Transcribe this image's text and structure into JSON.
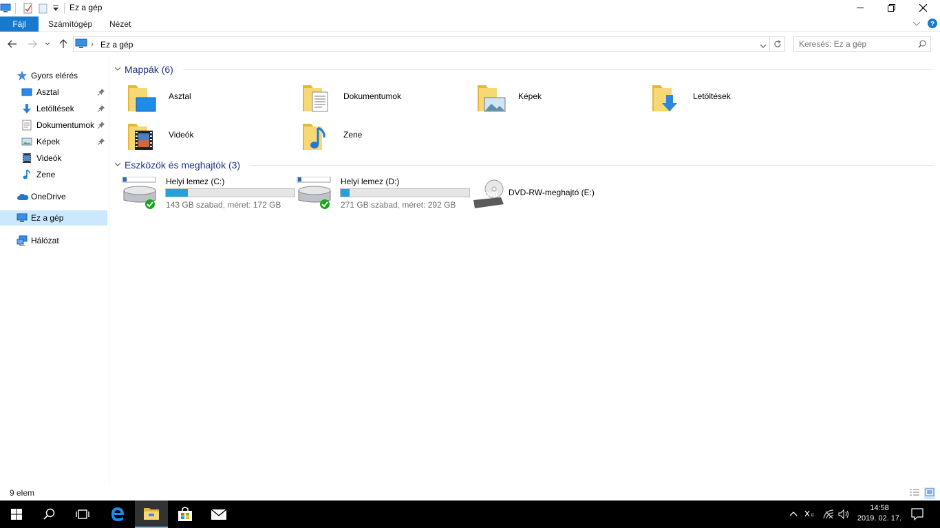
{
  "window": {
    "title": "Ez a gép"
  },
  "ribbon": {
    "tabs": [
      "Fájl",
      "Számítógép",
      "Nézet"
    ]
  },
  "address": {
    "path": "Ez a gép"
  },
  "search": {
    "placeholder": "Keresés: Ez a gép"
  },
  "nav": {
    "quick_access": "Gyors elérés",
    "items": [
      {
        "label": "Asztal",
        "icon": "desktop-icon",
        "pinned": true
      },
      {
        "label": "Letöltések",
        "icon": "downloads-icon",
        "pinned": true
      },
      {
        "label": "Dokumentumok",
        "icon": "documents-icon",
        "pinned": true
      },
      {
        "label": "Képek",
        "icon": "pictures-icon",
        "pinned": true
      },
      {
        "label": "Videók",
        "icon": "videos-icon",
        "pinned": false
      },
      {
        "label": "Zene",
        "icon": "music-icon",
        "pinned": false
      }
    ],
    "onedrive": "OneDrive",
    "this_pc": "Ez a gép",
    "network": "Hálózat"
  },
  "content": {
    "folders_header": "Mappák (6)",
    "folders": [
      "Asztal",
      "Dokumentumok",
      "Képek",
      "Letöltések",
      "Videók",
      "Zene"
    ],
    "devices_header": "Eszközök és meghajtók (3)",
    "drives": [
      {
        "name": "Helyi lemez (C:)",
        "info": "143 GB szabad, méret: 172 GB",
        "used_fraction": 0.17
      },
      {
        "name": "Helyi lemez (D:)",
        "info": "271 GB szabad, méret: 292 GB",
        "used_fraction": 0.07
      }
    ],
    "dvd": {
      "name": "DVD-RW-meghajtó (E:)",
      "badge": "DVD"
    }
  },
  "status": {
    "count": "9 elem"
  },
  "taskbar": {
    "time": "14:58",
    "date": "2019. 02. 17."
  },
  "colors": {
    "accent": "#1979ca",
    "header": "#1e3287",
    "selected": "#cce8ff",
    "drivebar": "#26a0da",
    "folder": "#f5c94a"
  }
}
